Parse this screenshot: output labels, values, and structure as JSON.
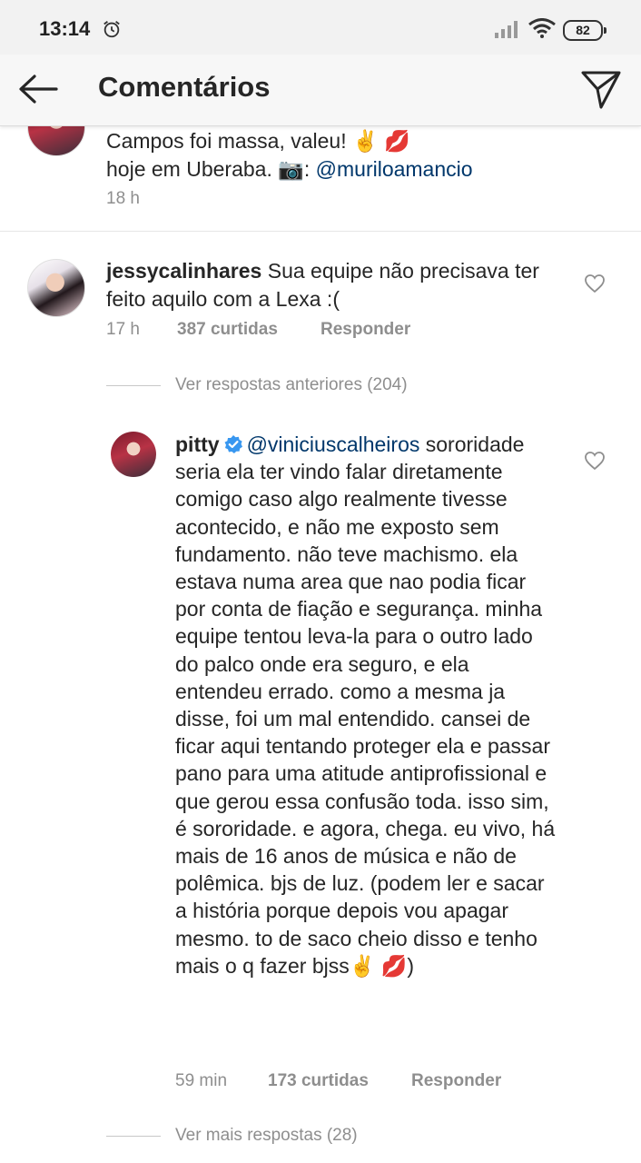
{
  "status_bar": {
    "time": "13:14",
    "battery": "82"
  },
  "app_bar": {
    "title": "Comentários"
  },
  "comments": [
    {
      "text_line1": "Campos foi massa, valeu! ✌️",
      "emoji_kiss": "💋",
      "text_line2": "hoje em Uberaba. 📷: ",
      "mention": "@muriloamancio",
      "time": "18 h"
    },
    {
      "username": "jessycalinhares",
      "text": " Sua equipe não precisava ter feito aquilo com a Lexa :(",
      "time": "17 h",
      "likes": "387 curtidas",
      "reply_label": "Responder"
    }
  ],
  "thread": {
    "previous_replies": "Ver respostas anteriores (204)",
    "reply": {
      "username": "pitty",
      "mention": "@viniciuscalheiros",
      "text": "sororidade seria ela ter vindo falar diretamente comigo caso algo realmente tivesse acontecido, e não me exposto sem fundamento. não teve machismo. ela estava numa area que nao podia ficar por conta de fiação e segurança. minha equipe tentou leva-la para o outro lado do palco onde era seguro, e ela entendeu errado. como a mesma ja disse, foi um mal entendido. cansei de ficar aqui tentando proteger ela e passar pano para uma atitude antiprofissional e que gerou essa confusão toda. isso sim, é sororidade. e agora, chega. eu vivo, há mais de 16 anos de música e não de polêmica. bjs de luz. (podem ler e sacar a história porque depois vou apagar mesmo. to de saco cheio disso e tenho mais o q fazer bjss✌️",
      "emoji_end": "💋",
      "closing": ")",
      "time": "59 min",
      "likes": "173 curtidas",
      "reply_label": "Responder"
    },
    "more_replies": "Ver mais respostas (28)"
  },
  "icons": {
    "back": "arrow-left-icon",
    "send": "paper-plane-icon",
    "like": "heart-outline-icon",
    "verified": "verified-badge-icon",
    "alarm": "alarm-clock-icon",
    "signal": "cell-signal-icon",
    "wifi": "wifi-icon"
  },
  "colors": {
    "mention": "#00376b",
    "meta": "#8e8e8e",
    "verified": "#3897f0"
  }
}
